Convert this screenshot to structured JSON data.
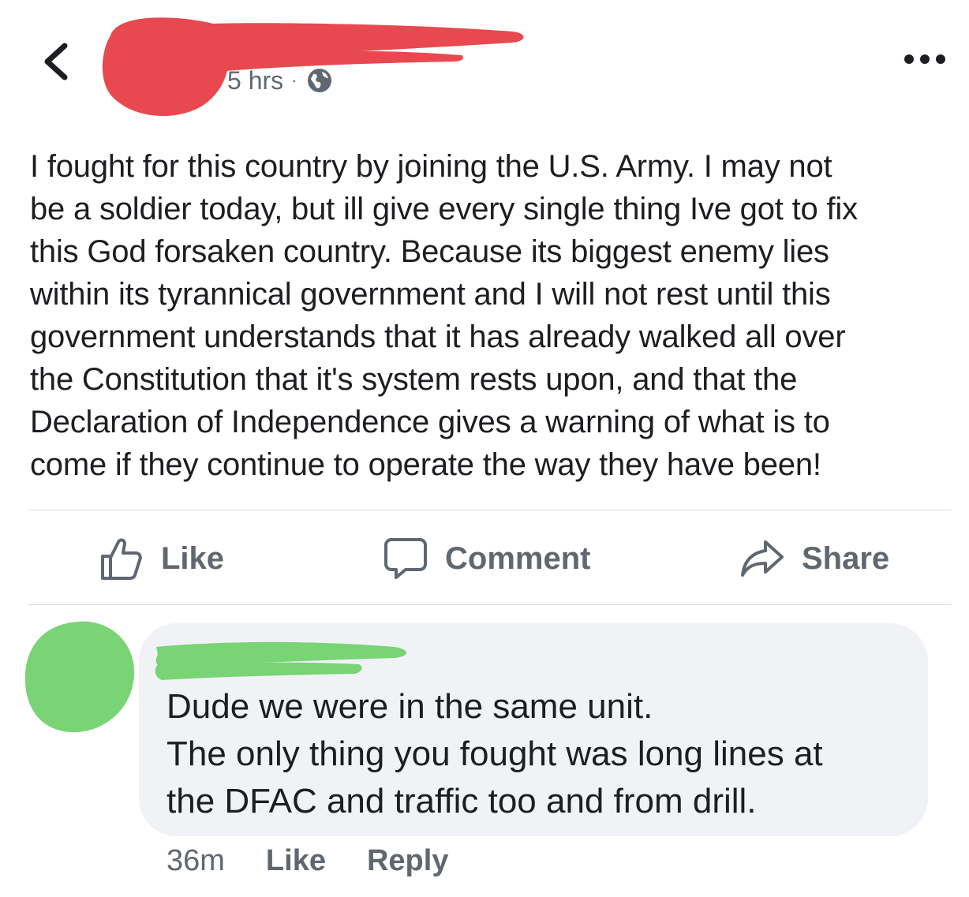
{
  "header": {
    "timestamp": "5 hrs",
    "separator": "·",
    "privacy_icon": "globe-icon",
    "back_icon": "chevron-left-icon",
    "more_icon": "more-horizontal-icon",
    "redaction_color": "#e8484f"
  },
  "post": {
    "lines": [
      "I fought for this country by joining the U.S. Army. I may not",
      "be a soldier today, but ill give every single thing Ive got to fix",
      "this God forsaken country. Because its biggest enemy lies",
      "within its tyrannical government and I will not rest until this",
      "government understands that it has already walked all over",
      "the Constitution that it's system rests upon, and that the",
      "Declaration of Independence gives a warning of what is to",
      "come if they continue to operate the way they have been!"
    ]
  },
  "actions": {
    "like_label": "Like",
    "like_icon": "thumbs-up-icon",
    "comment_label": "Comment",
    "comment_icon": "speech-bubble-icon",
    "share_label": "Share",
    "share_icon": "share-arrow-icon"
  },
  "comment": {
    "redaction_color": "#78d474",
    "lines": [
      "Dude we were in the same unit.",
      "The only thing you fought was long lines at",
      "the DFAC and traffic too and from drill."
    ],
    "time": "36m",
    "like_label": "Like",
    "reply_label": "Reply",
    "bubble_color": "#f0f2f5"
  }
}
